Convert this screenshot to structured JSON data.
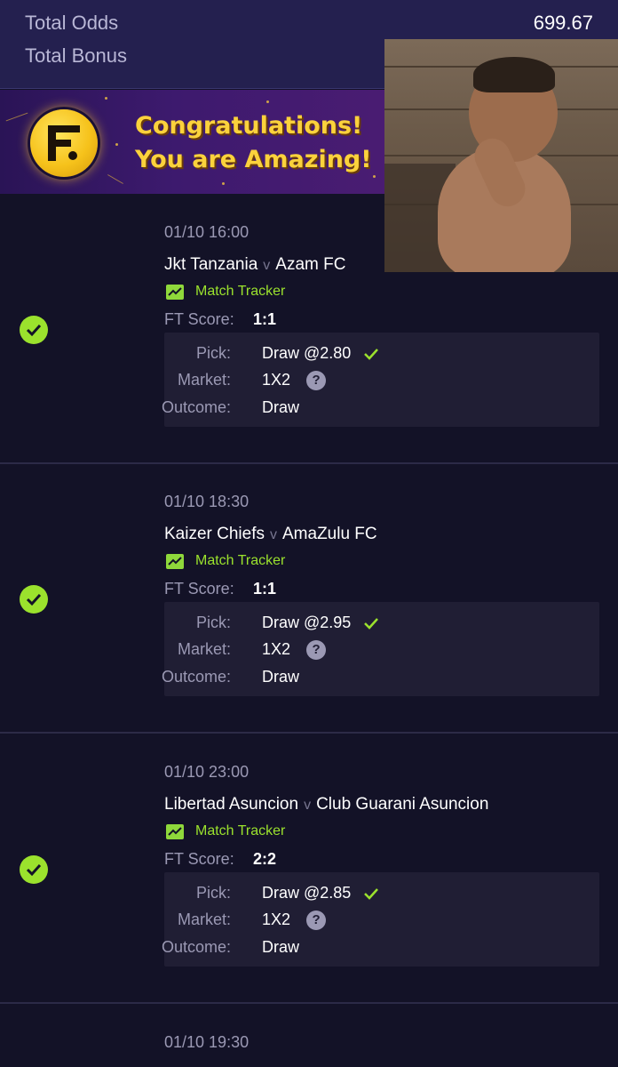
{
  "summary": {
    "total_odds_label": "Total Odds",
    "total_odds_value": "699.67",
    "total_bonus_label": "Total Bonus"
  },
  "banner": {
    "line1": "Congratulations!",
    "line2": "You are Amazing!"
  },
  "labels": {
    "tracker": "Match Tracker",
    "ft_score": "FT Score:",
    "pick": "Pick:",
    "market": "Market:",
    "outcome": "Outcome:",
    "vs": "v",
    "help": "?"
  },
  "bets": [
    {
      "time": "01/10 16:00",
      "home": "Jkt Tanzania",
      "away": "Azam FC",
      "score": "1:1",
      "pick": "Draw @2.80",
      "market": "1X2",
      "outcome": "Draw",
      "status": "won"
    },
    {
      "time": "01/10 18:30",
      "home": "Kaizer Chiefs",
      "away": "AmaZulu FC",
      "score": "1:1",
      "pick": "Draw @2.95",
      "market": "1X2",
      "outcome": "Draw",
      "status": "won"
    },
    {
      "time": "01/10 23:00",
      "home": "Libertad Asuncion",
      "away": "Club Guarani Asuncion",
      "score": "2:2",
      "pick": "Draw @2.85",
      "market": "1X2",
      "outcome": "Draw",
      "status": "won"
    },
    {
      "time": "01/10 19:30"
    }
  ],
  "colors": {
    "accent_green": "#9be22d",
    "background": "#131227",
    "header": "#24204f"
  },
  "icons": [
    "check-circle-icon",
    "chart-icon",
    "checkmark-icon",
    "help-icon",
    "logo-icon"
  ]
}
